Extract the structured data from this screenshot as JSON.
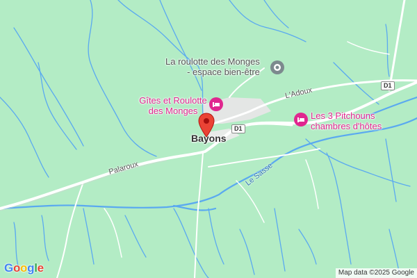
{
  "map": {
    "place": "Bayons",
    "pois": [
      {
        "id": "roulotte-spa",
        "line1": "La roulotte des Monges",
        "line2": "- espace bien-être",
        "icon": "spa-icon"
      },
      {
        "id": "gites-roulotte",
        "line1": "Gîtes et Roulotte",
        "line2": "des Monges",
        "icon": "hotel-icon"
      },
      {
        "id": "pitchouns",
        "line1": "Les 3 Pitchouns",
        "line2": "chambres d'hôtes",
        "icon": "hotel-icon"
      }
    ],
    "roads": {
      "d1_shield_a": "D1",
      "d1_shield_b": "D1",
      "adoux": "L'Adoux",
      "palaroux": "Palaroux"
    },
    "river": "Le Sasse",
    "logo": "Google",
    "attribution": "Map data ©2025 Google",
    "colors": {
      "land": "#b3ecc5",
      "water": "#5aa9f0",
      "road": "#ffffff",
      "poi_pink": "#e0278f",
      "pin": "#ea4335"
    }
  }
}
